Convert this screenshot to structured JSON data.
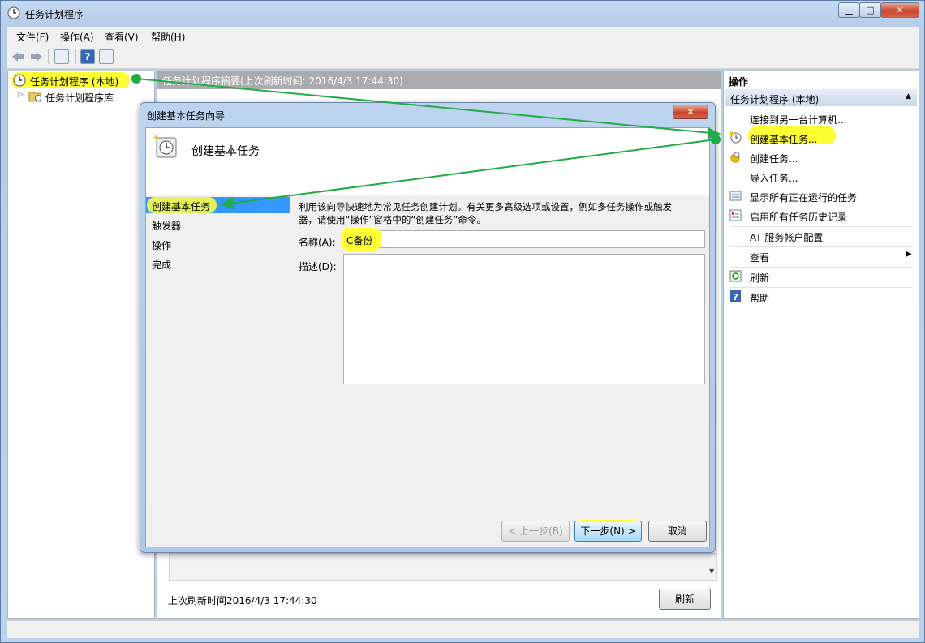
{
  "window": {
    "title": "任务计划程序",
    "minimize_glyph": "▁",
    "maximize_glyph": "□",
    "close_glyph": "✕"
  },
  "menubar": {
    "items": [
      {
        "label": "文件(F)"
      },
      {
        "label": "操作(A)"
      },
      {
        "label": "查看(V)"
      },
      {
        "label": "帮助(H)"
      }
    ]
  },
  "tree": {
    "root_label": "任务计划程序 (本地)",
    "child_label": "任务计划程序库"
  },
  "center": {
    "header": "任务计划程序摘要(上次刷新时间: 2016/4/3 17:44:30)",
    "last_refresh": "上次刷新时间2016/4/3 17:44:30",
    "refresh_button": "刷新"
  },
  "actions": {
    "pane_title": "操作",
    "section_title": "任务计划程序 (本地)",
    "items": [
      {
        "label": "连接到另一台计算机..."
      },
      {
        "label": "创建基本任务..."
      },
      {
        "label": "创建任务..."
      },
      {
        "label": "导入任务..."
      },
      {
        "label": "显示所有正在运行的任务"
      },
      {
        "label": "启用所有任务历史记录"
      },
      {
        "label": "AT 服务帐户配置"
      },
      {
        "label": "查看"
      },
      {
        "label": "刷新"
      },
      {
        "label": "帮助"
      }
    ]
  },
  "dialog": {
    "title": "创建基本任务向导",
    "close_glyph": "✕",
    "heading": "创建基本任务",
    "steps": [
      {
        "label": "创建基本任务"
      },
      {
        "label": "触发器"
      },
      {
        "label": "操作"
      },
      {
        "label": "完成"
      }
    ],
    "intro_line1": "利用该向导快速地为常见任务创建计划。有关更多高级选项或设置，例如多任务操作或触发",
    "intro_line2": "器，请使用“操作”窗格中的“创建任务”命令。",
    "name_label": "名称(A):",
    "name_value": "C备份",
    "desc_label": "描述(D):",
    "desc_value": "",
    "back_button": "< 上一步(B)",
    "next_button": "下一步(N) >",
    "cancel_button": "取消"
  },
  "colors": {
    "highlight": "#ffff33",
    "annotation_green": "#22aa44",
    "selection_blue": "#3399ff"
  }
}
